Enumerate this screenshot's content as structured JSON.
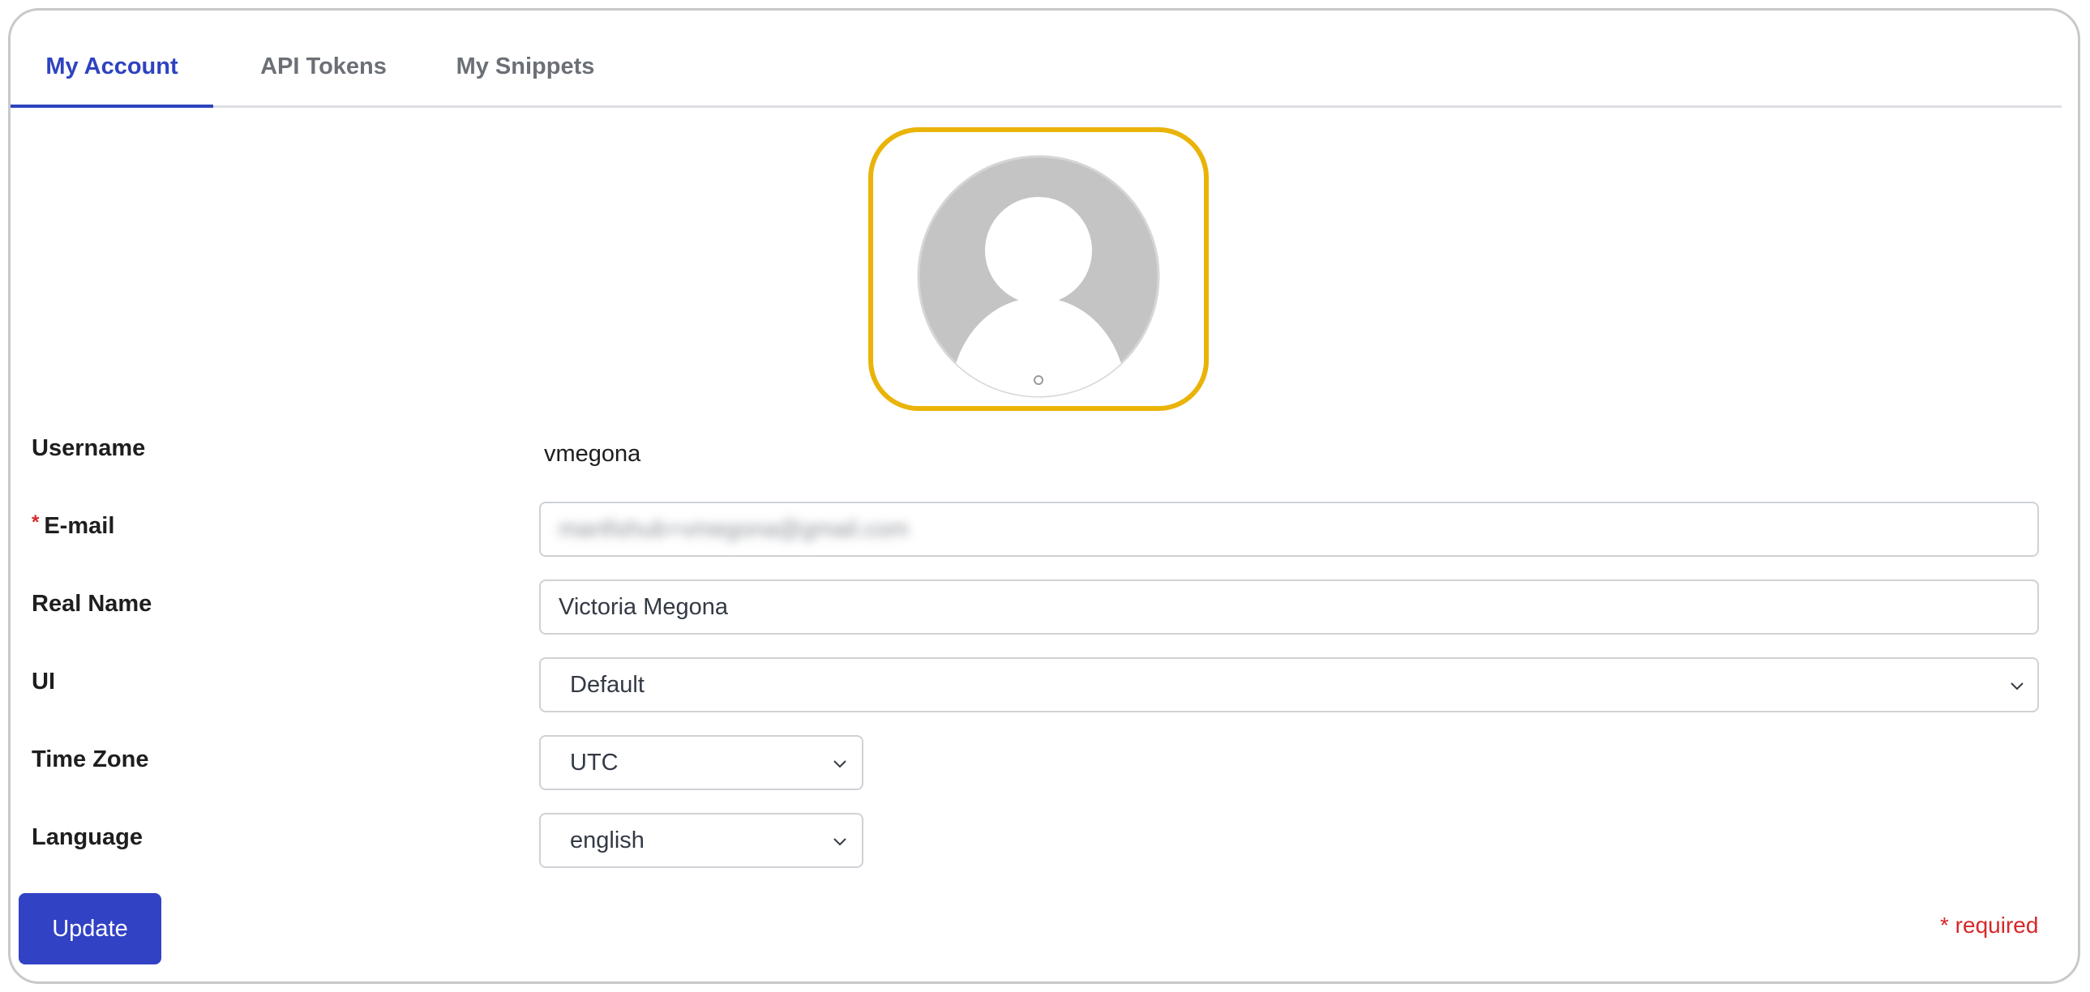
{
  "tabs": [
    {
      "label": "My Account",
      "active": true
    },
    {
      "label": "API Tokens",
      "active": false
    },
    {
      "label": "My Snippets",
      "active": false
    }
  ],
  "avatar": {
    "icon": "user-placeholder-icon",
    "highlight_color": "#eab308"
  },
  "form": {
    "username": {
      "label": "Username",
      "value": "vmegona"
    },
    "email": {
      "label": "E-mail",
      "required_mark": "*",
      "value": "manfishub+vmegona@gmail.com"
    },
    "real_name": {
      "label": "Real Name",
      "value": "Victoria Megona"
    },
    "ui": {
      "label": "UI",
      "value": "Default"
    },
    "time_zone": {
      "label": "Time Zone",
      "value": "UTC"
    },
    "language": {
      "label": "Language",
      "value": "english"
    }
  },
  "actions": {
    "update_label": "Update"
  },
  "required_note": "* required",
  "colors": {
    "accent": "#2e43c0",
    "button": "#3242c5",
    "required": "#d62828"
  }
}
